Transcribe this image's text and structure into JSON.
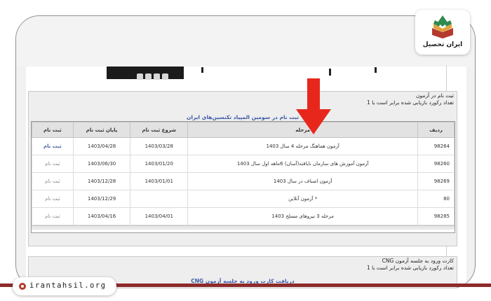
{
  "logo": {
    "text": "ایران تحصیل"
  },
  "site_badge": {
    "text": "irantahsil.org"
  },
  "section1": {
    "title": "ثبت نام در آزمون",
    "record_count": "تعداد رکورد بازیابی شده برابر است با 1",
    "link": "ثبت نام در سومین المپیاد تکنسین‌های ایران",
    "columns": [
      "ردیف",
      "مرحله",
      "شروع ثبت نام",
      "پایان ثبت نام",
      "ثبت نام"
    ],
    "rows": [
      {
        "id": "98264",
        "stage": "آزمون هماهنگ مرحله 4 سال 1403",
        "start": "1403/03/28",
        "end": "1403/04/28",
        "action": "ثبت نام"
      },
      {
        "id": "98260",
        "stage": "آزمون آموزش های سازمان نایافته(آسان) 6ماهه اول سال 1403",
        "start": "1403/01/20",
        "end": "1403/06/30",
        "action": "ثبت نام"
      },
      {
        "id": "98269",
        "stage": "آزمون اصناف در سال 1403",
        "start": "1403/01/01",
        "end": "1403/12/28",
        "action": "ثبت نام"
      },
      {
        "id": "80",
        "stage": "* آزمون آنلاین",
        "start": "",
        "end": "1403/12/29",
        "action": "ثبت نام"
      },
      {
        "id": "98285",
        "stage": "مرحله 3 نیروهای مسلح 1403",
        "start": "1403/04/01",
        "end": "1403/04/16",
        "action": "ثبت نام"
      }
    ]
  },
  "section2": {
    "title": "کارت ورود به جلسه آزمون CNG",
    "record_count": "تعداد رکورد بازیابی شده برابر است با 1",
    "link": "دریافت کارت ورود به جلسه آزمون CNG"
  },
  "colors": {
    "accent_blue": "#3a59a6",
    "arrow_red": "#e8271c",
    "band_red": "#8e2a2a"
  }
}
